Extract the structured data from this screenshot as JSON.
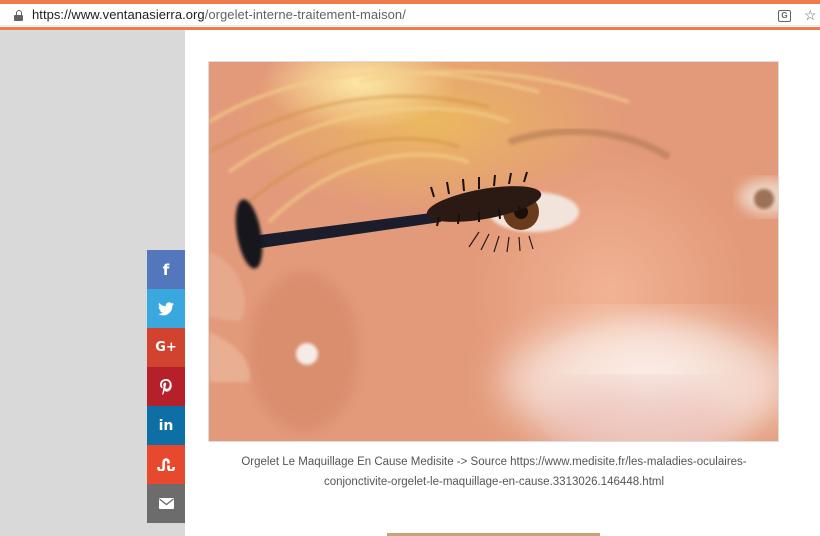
{
  "browser": {
    "url_domain": "https://www.ventanasierra.org",
    "url_path": "/orgelet-interne-traitement-maison/"
  },
  "article": {
    "image_caption": "Orgelet Le Maquillage En Cause Medisite -> Source https://www.medisite.fr/les-maladies-oculaires-conjonctivite-orgelet-le-maquillage-en-cause.3313026.146448.html"
  },
  "share_bar": {
    "buttons": [
      {
        "name": "facebook",
        "glyph": "f",
        "color": "#5476bd"
      },
      {
        "name": "twitter",
        "glyph": "🐦",
        "color": "#39a8df"
      },
      {
        "name": "google-plus",
        "glyph": "G+",
        "color": "#d2432f"
      },
      {
        "name": "pinterest",
        "glyph": "P",
        "color": "#b6202a"
      },
      {
        "name": "linkedin",
        "glyph": "in",
        "color": "#0e6ea6"
      },
      {
        "name": "stumbleupon",
        "glyph": "su",
        "color": "#e8482d"
      },
      {
        "name": "email",
        "glyph": "✉",
        "color": "#6c6c6c"
      }
    ]
  }
}
